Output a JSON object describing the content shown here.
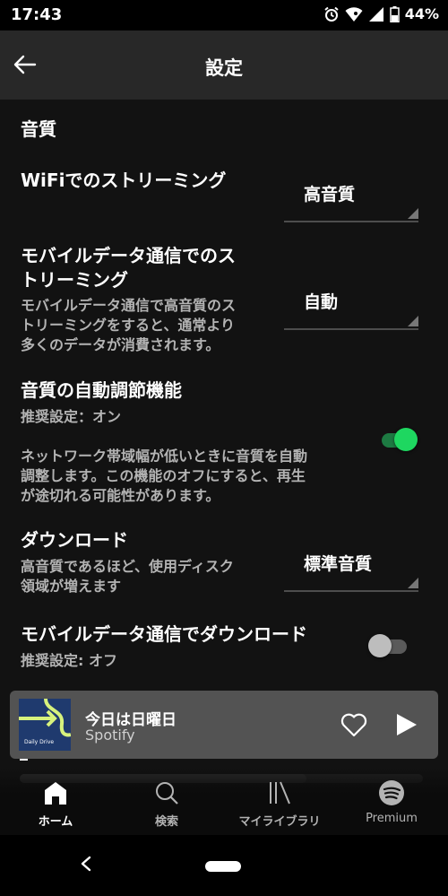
{
  "status_bar": {
    "time": "17:43",
    "battery_percent": "44%"
  },
  "app_bar": {
    "title": "設定"
  },
  "section": {
    "title": "音質"
  },
  "settings": {
    "wifi_streaming": {
      "title": "WiFiでのストリーミング",
      "value": "高音質"
    },
    "mobile_streaming": {
      "title_line1": "モバイルデータ通信でのス",
      "title_line2": "トリーミング",
      "desc_line1": "モバイルデータ通信で高音質のス",
      "desc_line2": "トリーミングをすると、通常より",
      "desc_line3": "多くのデータが消費されます。",
      "value": "自動"
    },
    "auto_adjust": {
      "title": "音質の自動調節機能",
      "recommend": "推奨設定：オン",
      "desc_line1": "ネットワーク帯域幅が低いときに音質を自動",
      "desc_line2": "調整します。この機能のオフにすると、再生",
      "desc_line3": "が途切れる可能性があります。",
      "enabled": true
    },
    "download": {
      "title": "ダウンロード",
      "desc_line1": "高音質であるほど、使用ディスク",
      "desc_line2": "領域が増えます",
      "value": "標準音質"
    },
    "mobile_download": {
      "title": "モバイルデータ通信でダウンロード",
      "recommend": "推奨設定: オフ",
      "enabled": false
    }
  },
  "mini_player": {
    "track_title": "今日は日曜日",
    "artist": "Spotify",
    "art_caption": "Daily Drive"
  },
  "bottom_nav": {
    "items": [
      {
        "label": "ホーム",
        "icon": "home-icon"
      },
      {
        "label": "検索",
        "icon": "search-icon"
      },
      {
        "label": "マイライブラリ",
        "icon": "library-icon"
      },
      {
        "label": "Premium",
        "icon": "spotify-icon"
      }
    ]
  },
  "colors": {
    "accent": "#1ed760",
    "toggle_on_track": "#1d7a42",
    "toggle_off_knob": "#bdbdbd",
    "toggle_off_track": "#5a5a5a",
    "player_bg": "#535353"
  }
}
